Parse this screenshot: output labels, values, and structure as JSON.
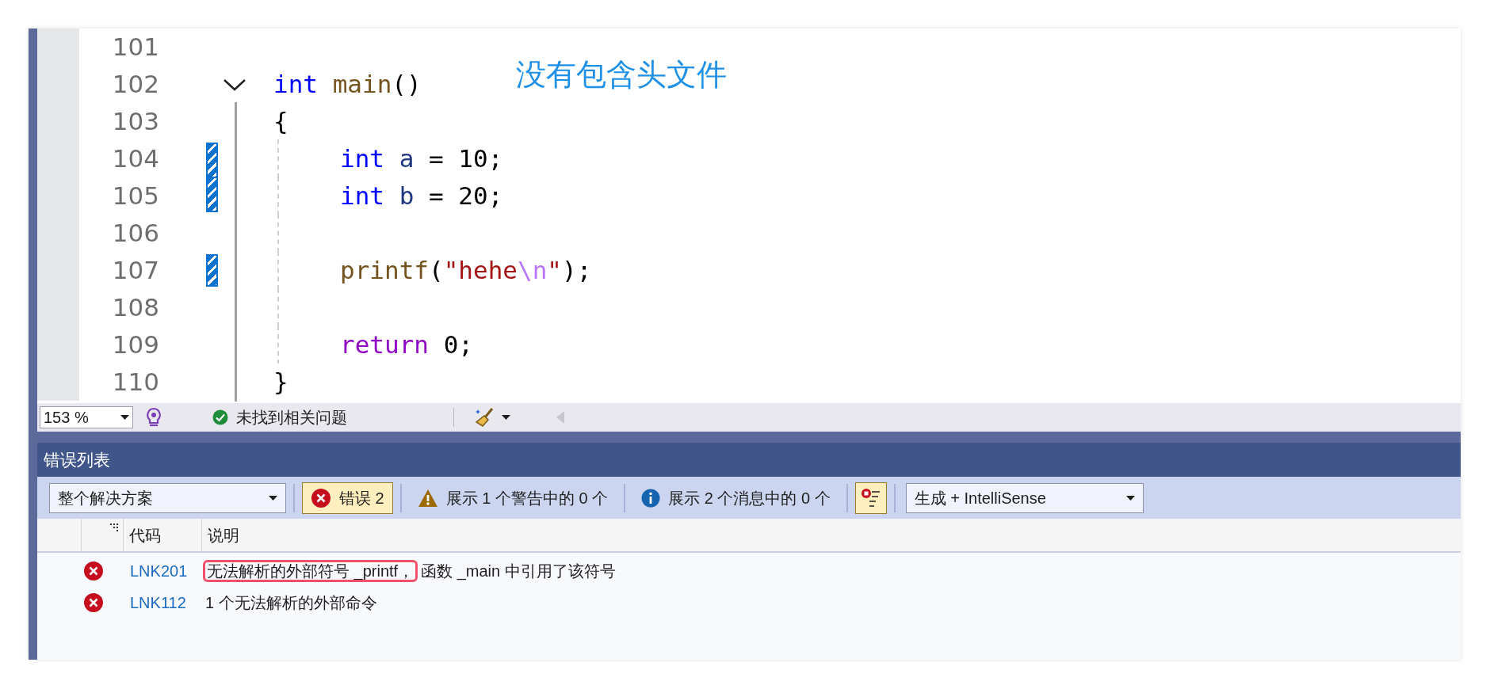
{
  "editor": {
    "annotation": "没有包含头文件",
    "lines": [
      {
        "number": "101",
        "changed": false,
        "indented": false
      },
      {
        "number": "102",
        "changed": false,
        "indented": false,
        "expanded": true,
        "tokens": [
          {
            "text": "int",
            "kind": "keyword",
            "sp": true
          },
          {
            "text": "main",
            "kind": "function"
          },
          {
            "text": "()",
            "kind": "plain"
          }
        ]
      },
      {
        "number": "103",
        "changed": false,
        "indented": false,
        "tokens": [
          {
            "text": "{",
            "kind": "plain"
          }
        ]
      },
      {
        "number": "104",
        "changed": true,
        "indented": true,
        "tokens": [
          {
            "text": "int",
            "kind": "keyword",
            "sp": true
          },
          {
            "text": "a",
            "kind": "variable",
            "sp": true
          },
          {
            "text": "=",
            "kind": "plain",
            "sp": true
          },
          {
            "text": "10;",
            "kind": "plain"
          }
        ]
      },
      {
        "number": "105",
        "changed": true,
        "indented": true,
        "tokens": [
          {
            "text": "int",
            "kind": "keyword",
            "sp": true
          },
          {
            "text": "b",
            "kind": "variable",
            "sp": true
          },
          {
            "text": "=",
            "kind": "plain",
            "sp": true
          },
          {
            "text": "20;",
            "kind": "plain"
          }
        ]
      },
      {
        "number": "106",
        "changed": false,
        "indented": true
      },
      {
        "number": "107",
        "changed": true,
        "indented": true,
        "tokens": [
          {
            "text": "printf",
            "kind": "function"
          },
          {
            "text": "(",
            "kind": "plain"
          },
          {
            "text": "\"hehe",
            "kind": "string"
          },
          {
            "text": "\\n",
            "kind": "escape"
          },
          {
            "text": "\"",
            "kind": "string"
          },
          {
            "text": ");",
            "kind": "plain"
          }
        ]
      },
      {
        "number": "108",
        "changed": false,
        "indented": true
      },
      {
        "number": "109",
        "changed": false,
        "indented": true,
        "tokens": [
          {
            "text": "return",
            "kind": "control",
            "sp": true
          },
          {
            "text": "0;",
            "kind": "plain"
          }
        ]
      },
      {
        "number": "110",
        "changed": false,
        "indented": false,
        "tokens": [
          {
            "text": "}",
            "kind": "plain"
          }
        ]
      }
    ]
  },
  "status_bar": {
    "zoom": "153 %",
    "issues": "未找到相关问题"
  },
  "error_list": {
    "title": "错误列表",
    "scope": "整个解决方案",
    "filters": [
      {
        "kind": "errors",
        "label": "错误 2",
        "selected": true
      },
      {
        "kind": "warnings",
        "label": "展示 1 个警告中的 0 个",
        "selected": false
      },
      {
        "kind": "messages",
        "label": "展示 2 个消息中的 0 个",
        "selected": false
      }
    ],
    "filter_toggle": {
      "selected": true
    },
    "source": "生成 + IntelliSense",
    "columns": [
      "代码",
      "说明"
    ],
    "rows": [
      {
        "kind": "error",
        "code": "LNK201",
        "description_parts": [
          {
            "text": "无法解析的外部符号 _printf，",
            "boxed": true
          },
          {
            "text": "函数 _main 中引用了该符号",
            "boxed": false
          }
        ]
      },
      {
        "kind": "error",
        "code": "LNK112",
        "description_parts": [
          {
            "text": "1 个无法解析的外部命令",
            "boxed": false
          }
        ]
      }
    ]
  }
}
